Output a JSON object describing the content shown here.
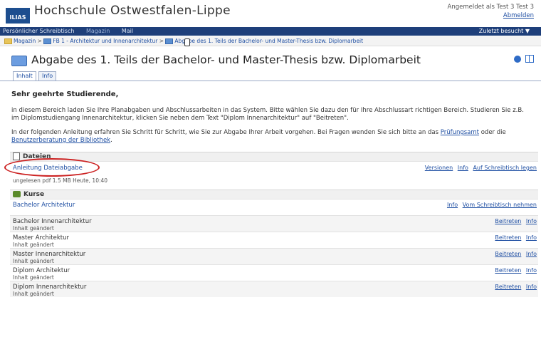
{
  "header": {
    "logo": "ILIAS",
    "site_title": "Hochschule Ostwestfalen-Lippe",
    "login_text": "Angemeldet als Test 3 Test 3",
    "logout_label": "Abmelden"
  },
  "mainnav": {
    "items": [
      "Persönlicher Schreibtisch",
      "Magazin",
      "Mail"
    ],
    "recent_label": "Zuletzt besucht ▼"
  },
  "breadcrumb": {
    "items": [
      "Magazin",
      "FB 1 - Architektur und Innenarchitektur",
      "Abgabe des 1. Teils der Bachelor- und Master-Thesis bzw. Diplomarbeit"
    ],
    "separator": ">"
  },
  "page": {
    "title": "Abgabe des 1. Teils der Bachelor- und Master-Thesis bzw. Diplomarbeit",
    "tabs": [
      "Inhalt",
      "Info"
    ]
  },
  "intro": {
    "greeting": "Sehr geehrte Studierende,",
    "para1": "in diesem Bereich laden Sie Ihre Planabgaben und Abschlussarbeiten in das System. Bitte wählen Sie dazu den für Ihre Abschlussart richtigen Bereich. Studieren Sie z.B. im Diplomstudiengang Innenarchitektur, klicken Sie neben dem Text \"Diplom Innenarchitektur\" auf \"Beitreten\".",
    "para2_a": "In der folgenden Anleitung erfahren Sie Schritt für Schritt, wie Sie zur Abgabe Ihrer Arbeit vorgehen. Bei Fragen wenden Sie sich bitte an das",
    "para2_link1": "Prüfungsamt",
    "para2_b": " oder die ",
    "para2_link2": "Benutzerberatung der Bibliothek",
    "para2_c": "."
  },
  "files": {
    "heading": "Dateien",
    "item": {
      "title": "Anleitung Dateiabgabe",
      "meta": "ungelesen   pdf   1.5 MB   Heute, 10:40",
      "actions": [
        "Versionen",
        "Info",
        "Auf Schreibtisch legen"
      ]
    }
  },
  "courses": {
    "heading": "Kurse",
    "items": [
      {
        "title": "Bachelor Architektur",
        "sub": "",
        "actions": [
          "Info",
          "Vom Schreibtisch nehmen"
        ]
      },
      {
        "title": "Bachelor Innenarchitektur",
        "sub": "Inhalt geändert",
        "actions": [
          "Beitreten",
          "Info"
        ]
      },
      {
        "title": "Master Architektur",
        "sub": "Inhalt geändert",
        "actions": [
          "Beitreten",
          "Info"
        ]
      },
      {
        "title": "Master Innenarchitektur",
        "sub": "Inhalt geändert",
        "actions": [
          "Beitreten",
          "Info"
        ]
      },
      {
        "title": "Diplom Architektur",
        "sub": "Inhalt geändert",
        "actions": [
          "Beitreten",
          "Info"
        ]
      },
      {
        "title": "Diplom Innenarchitektur",
        "sub": "Inhalt geändert",
        "actions": [
          "Beitreten",
          "Info"
        ]
      }
    ]
  },
  "colors": {
    "nav_bar": "#1e3f7a",
    "link": "#1f4fa3",
    "highlight_ellipse": "#cc2222"
  }
}
